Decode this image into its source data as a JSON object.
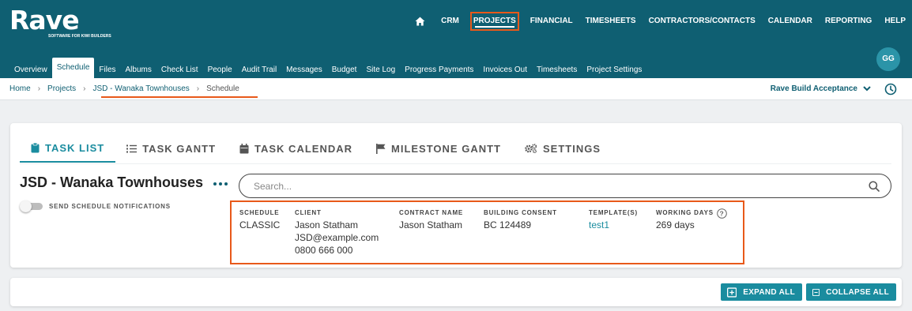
{
  "brand": {
    "name": "Rave",
    "tagline": "SOFTWARE FOR KIWI BUILDERS"
  },
  "topnav": {
    "home_icon": "home-icon",
    "items": [
      "CRM",
      "PROJECTS",
      "FINANCIAL",
      "TIMESHEETS",
      "CONTRACTORS/CONTACTS",
      "CALENDAR",
      "REPORTING",
      "HELP"
    ],
    "active": "PROJECTS"
  },
  "subnav": {
    "items": [
      "Overview",
      "Schedule",
      "Files",
      "Albums",
      "Check List",
      "People",
      "Audit Trail",
      "Messages",
      "Budget",
      "Site Log",
      "Progress Payments",
      "Invoices Out",
      "Timesheets",
      "Project Settings"
    ],
    "active": "Schedule"
  },
  "user": {
    "initials": "GG"
  },
  "breadcrumb": [
    "Home",
    "Projects",
    "JSD - Wanaka Townhouses",
    "Schedule"
  ],
  "project_switch": {
    "label": "Rave Build Acceptance"
  },
  "tabs": [
    {
      "label": "TASK LIST",
      "icon": "clipboard-icon",
      "active": true
    },
    {
      "label": "TASK GANTT",
      "icon": "list-icon",
      "active": false
    },
    {
      "label": "TASK CALENDAR",
      "icon": "calendar-icon",
      "active": false
    },
    {
      "label": "MILESTONE GANTT",
      "icon": "flag-icon",
      "active": false
    },
    {
      "label": "SETTINGS",
      "icon": "gears-icon",
      "active": false
    }
  ],
  "project": {
    "title": "JSD - Wanaka Townhouses",
    "notifications_label": "SEND SCHEDULE NOTIFICATIONS",
    "notifications_on": false
  },
  "search": {
    "placeholder": "Search...",
    "value": ""
  },
  "details": {
    "schedule": {
      "label": "SCHEDULE",
      "value": "CLASSIC"
    },
    "client": {
      "label": "CLIENT",
      "name": "Jason Statham",
      "email": "JSD@example.com",
      "phone": "0800 666 000"
    },
    "contract_name": {
      "label": "CONTRACT NAME",
      "value": "Jason Statham"
    },
    "building_consent": {
      "label": "BUILDING CONSENT",
      "value": "BC 124489"
    },
    "templates": {
      "label": "TEMPLATE(S)",
      "value": "test1"
    },
    "working_days": {
      "label": "WORKING DAYS",
      "value": "269 days"
    }
  },
  "actions": {
    "expand_all": "EXPAND ALL",
    "collapse_all": "COLLAPSE ALL"
  },
  "colors": {
    "header_bg": "#0f5f72",
    "accent": "#1a8c9f",
    "highlight": "#e8591a",
    "avatar_bg": "#2b94a8"
  }
}
